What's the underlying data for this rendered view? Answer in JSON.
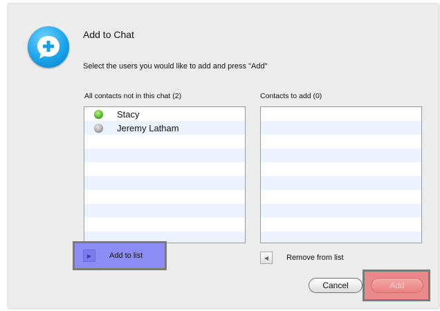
{
  "dialog": {
    "title": "Add to Chat",
    "instructions": "Select the users you would like to add and press \"Add\""
  },
  "left_list": {
    "label": "All contacts not in this chat (2)",
    "items": [
      {
        "name": "Stacy",
        "status": "online",
        "icon": "online-status-icon"
      },
      {
        "name": "Jeremy Latham",
        "status": "offline",
        "icon": "offline-status-icon"
      }
    ]
  },
  "right_list": {
    "label": "Contacts to add (0)",
    "items": []
  },
  "buttons": {
    "add_to_list": "Add to list",
    "remove_from_list": "Remove from list",
    "cancel": "Cancel",
    "add": "Add"
  },
  "colors": {
    "online": "#58b82a",
    "offline": "#a9a9a9",
    "add_to_list_highlight": "#8c8cf5",
    "add_highlight": "#e98a8a",
    "dialog_bg": "#ececec"
  },
  "icons": {
    "app": "chat-plus-icon",
    "add_arrow": "arrow-right-icon",
    "remove_arrow": "arrow-left-icon"
  }
}
